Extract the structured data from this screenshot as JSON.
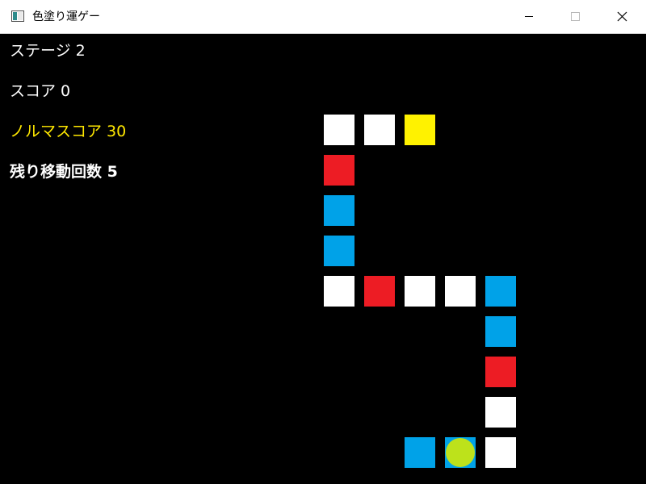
{
  "window": {
    "title": "色塗り運ゲー",
    "icons": {
      "app": "app-window-icon",
      "minimize": "minimize-icon",
      "maximize": "maximize-icon",
      "close": "close-icon"
    }
  },
  "hud": {
    "stage": "ステージ 2",
    "score": "スコア 0",
    "norm_score": "ノルマスコア 30",
    "remaining_moves": "残り移動回数 5"
  },
  "colors": {
    "background": "#000000",
    "white": "#ffffff",
    "red": "#ed1c24",
    "blue": "#00a2e8",
    "yellow": "#fff200",
    "player": "#bde21b",
    "norm_text": "#ffe800"
  },
  "board": {
    "tiles": [
      {
        "col": 0,
        "row": 0,
        "color": "white"
      },
      {
        "col": 1,
        "row": 0,
        "color": "white"
      },
      {
        "col": 2,
        "row": 0,
        "color": "yellow"
      },
      {
        "col": 0,
        "row": 1,
        "color": "red"
      },
      {
        "col": 0,
        "row": 2,
        "color": "blue"
      },
      {
        "col": 0,
        "row": 3,
        "color": "blue"
      },
      {
        "col": 0,
        "row": 4,
        "color": "white"
      },
      {
        "col": 1,
        "row": 4,
        "color": "red"
      },
      {
        "col": 2,
        "row": 4,
        "color": "white"
      },
      {
        "col": 3,
        "row": 4,
        "color": "white"
      },
      {
        "col": 4,
        "row": 4,
        "color": "blue"
      },
      {
        "col": 4,
        "row": 5,
        "color": "blue"
      },
      {
        "col": 4,
        "row": 6,
        "color": "red"
      },
      {
        "col": 4,
        "row": 7,
        "color": "white"
      },
      {
        "col": 2,
        "row": 8,
        "color": "blue"
      },
      {
        "col": 3,
        "row": 8,
        "color": "blue"
      },
      {
        "col": 4,
        "row": 8,
        "color": "white"
      }
    ],
    "player": {
      "col": 3,
      "row": 8
    }
  }
}
